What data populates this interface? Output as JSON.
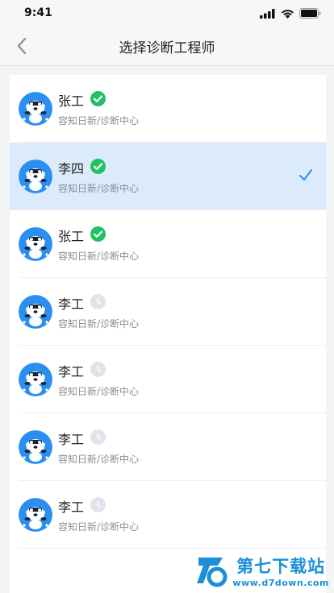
{
  "status_bar": {
    "time": "9:41"
  },
  "nav": {
    "title": "选择诊断工程师"
  },
  "colors": {
    "accent": "#2a8ff0",
    "verified": "#22c064",
    "pending": "#dfe3ea",
    "selected_bg": "#dcebfb"
  },
  "engineers": [
    {
      "name": "张工",
      "subtitle": "容知日新/诊断中心",
      "status": "verified",
      "selected": false
    },
    {
      "name": "李四",
      "subtitle": "容知日新/诊断中心",
      "status": "verified",
      "selected": true
    },
    {
      "name": "张工",
      "subtitle": "容知日新/诊断中心",
      "status": "verified",
      "selected": false
    },
    {
      "name": "李工",
      "subtitle": "容知日新/诊断中心",
      "status": "pending",
      "selected": false
    },
    {
      "name": "李工",
      "subtitle": "容知日新/诊断中心",
      "status": "pending",
      "selected": false
    },
    {
      "name": "李工",
      "subtitle": "容知日新/诊断中心",
      "status": "pending",
      "selected": false
    },
    {
      "name": "李工",
      "subtitle": "容知日新/诊断中心",
      "status": "pending",
      "selected": false
    }
  ],
  "watermark": {
    "title": "第七下载站",
    "url": "www.d7down.com"
  }
}
